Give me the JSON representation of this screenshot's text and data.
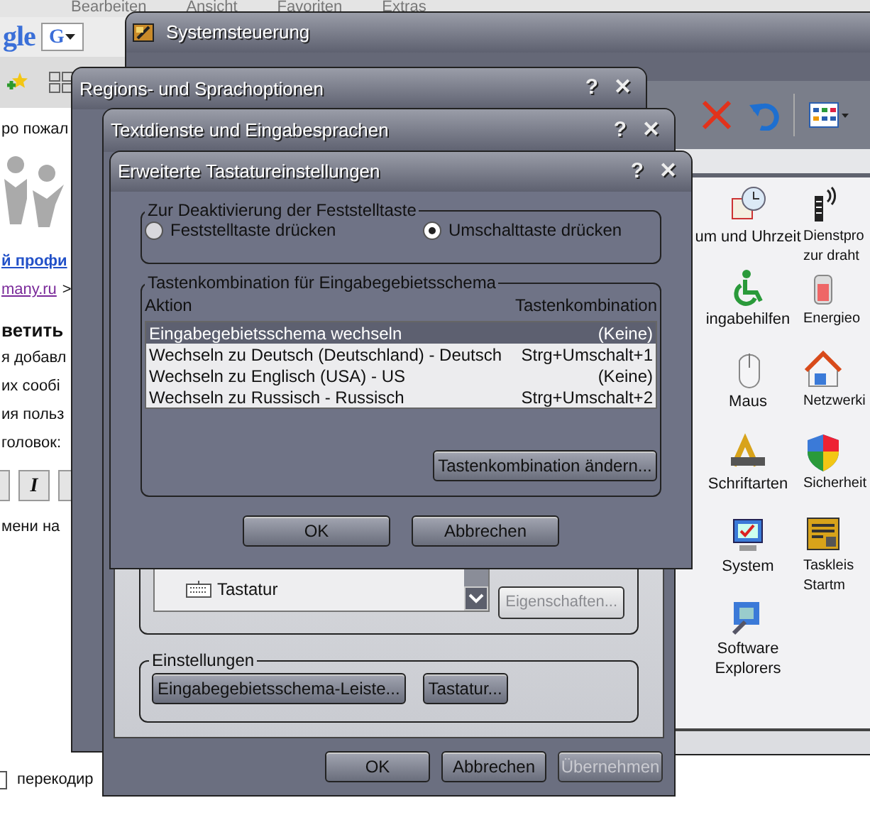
{
  "browser": {
    "menu": [
      "Bearbeiten",
      "Ansicht",
      "Favoriten",
      "Extras"
    ],
    "logo": "gle",
    "engine_button": "G",
    "page": [
      {
        "kind": "text",
        "text": "ро пожал"
      },
      {
        "kind": "image"
      },
      {
        "kind": "link",
        "text": "й профи"
      },
      {
        "kind": "domain",
        "text": "many.ru",
        "suffix": ">"
      },
      {
        "kind": "heading",
        "text": "ветить"
      },
      {
        "kind": "text",
        "text": "я добавл"
      },
      {
        "kind": "text",
        "text": "их сообі"
      },
      {
        "kind": "text",
        "text": "ия польз"
      },
      {
        "kind": "text",
        "text": "головок:"
      },
      {
        "kind": "format_buttons",
        "text": "I"
      },
      {
        "kind": "text",
        "text": "мени на"
      }
    ],
    "checkbox": {
      "label": "перекодир",
      "checked": false
    }
  },
  "control_panel": {
    "title": "Systemsteuerung",
    "icons": [
      {
        "kind": "clock",
        "lines": [
          "um und Uhrzeit"
        ]
      },
      {
        "kind": "tower",
        "lines": [
          "Dienstpro",
          "zur draht"
        ]
      },
      {
        "kind": "wheelchair",
        "lines": [
          "ingabehilfen"
        ]
      },
      {
        "kind": "battery",
        "lines": [
          "Energieo"
        ]
      },
      {
        "kind": "mouse",
        "lines": [
          "Maus"
        ]
      },
      {
        "kind": "network",
        "lines": [
          "Netzwerki"
        ]
      },
      {
        "kind": "fonts",
        "lines": [
          "Schriftarten"
        ]
      },
      {
        "kind": "shield",
        "lines": [
          "Sicherheit"
        ]
      },
      {
        "kind": "system",
        "lines": [
          "System"
        ]
      },
      {
        "kind": "taskbar",
        "lines": [
          "Taskleis",
          "Startm"
        ]
      },
      {
        "kind": "software",
        "lines": [
          "Software",
          "Explorers"
        ]
      }
    ]
  },
  "regional_options": {
    "title": "Regions- und Sprachoptionen",
    "title_buttons": [
      "?",
      "✕"
    ]
  },
  "text_services": {
    "title": "Textdienste und Eingabesprachen",
    "title_buttons": [
      "?",
      "✕"
    ],
    "tree_items": [
      {
        "label": "Tastatur"
      }
    ],
    "properties_button": {
      "label": "Eigenschaften...",
      "disabled": true
    },
    "settings_group": {
      "legend": "Einstellungen",
      "buttons": [
        "Eingabegebietsschema-Leiste...",
        "Tastatur..."
      ]
    },
    "buttons": [
      {
        "label": "OK",
        "disabled": false
      },
      {
        "label": "Abbrechen",
        "disabled": false
      },
      {
        "label": "Übernehmen",
        "disabled": true
      }
    ]
  },
  "advanced_keys": {
    "title": "Erweiterte Tastatureinstellungen",
    "title_buttons": [
      "?",
      "✕"
    ],
    "caps_group": {
      "legend": "Zur Deaktivierung der Feststelltaste",
      "options": [
        {
          "label": "Feststelltaste drücken",
          "selected": false
        },
        {
          "label": "Umschalttaste drücken",
          "selected": true
        }
      ]
    },
    "hotkey_group": {
      "legend": "Tastenkombination für Eingabegebietsschema",
      "columns": [
        "Aktion",
        "Tastenkombination"
      ],
      "rows": [
        {
          "action": "Eingabegebietsschema wechseln",
          "keys": "(Keine)",
          "selected": true
        },
        {
          "action": "Wechseln zu Deutsch (Deutschland) - Deutsch",
          "keys": "Strg+Umschalt+1",
          "selected": false
        },
        {
          "action": "Wechseln zu Englisch (USA) - US",
          "keys": "(Keine)",
          "selected": false
        },
        {
          "action": "Wechseln zu Russisch - Russisch",
          "keys": "Strg+Umschalt+2",
          "selected": false
        }
      ],
      "button": "Tastenkombination ändern..."
    },
    "buttons": [
      "OK",
      "Abbrechen"
    ]
  }
}
